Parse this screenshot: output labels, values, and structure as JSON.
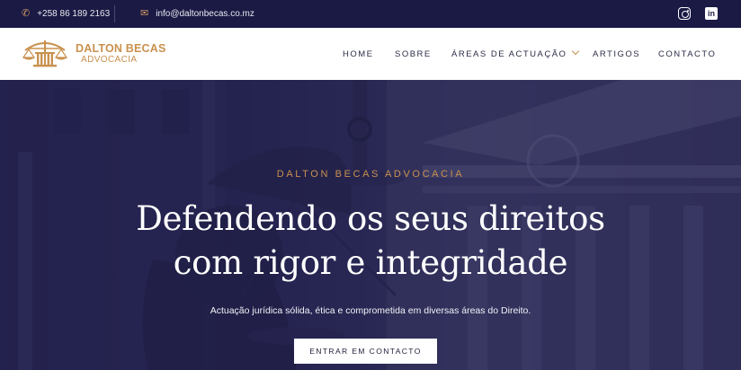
{
  "topbar": {
    "phone": "+258 86 189 2163",
    "email": "info@daltonbecas.co.mz",
    "linkedin_glyph": "in"
  },
  "header": {
    "logo_name": "DALTON BECAS",
    "logo_sub": "ADVOCACIA",
    "nav": [
      {
        "label": "HOME"
      },
      {
        "label": "SOBRE"
      },
      {
        "label": "ÁREAS DE ACTUAÇÃO"
      },
      {
        "label": "ARTIGOS"
      },
      {
        "label": "CONTACTO"
      }
    ]
  },
  "hero": {
    "eyebrow": "DALTON BECAS ADVOCACIA",
    "headline_line1": "Defendendo os seus direitos",
    "headline_line2": "com rigor e integridade",
    "subtitle": "Actuação jurídica sólida, ética e comprometida em diversas áreas do Direito.",
    "cta": "ENTRAR EM CONTACTO"
  },
  "colors": {
    "navy": "#1b1a45",
    "gold": "#c9914f",
    "white": "#ffffff"
  },
  "icons": {
    "phone": "phone-icon",
    "email": "email-icon",
    "instagram": "instagram-icon",
    "linkedin": "linkedin-icon",
    "logo": "scales-of-justice-icon",
    "dropdown": "chevron-down-icon"
  }
}
